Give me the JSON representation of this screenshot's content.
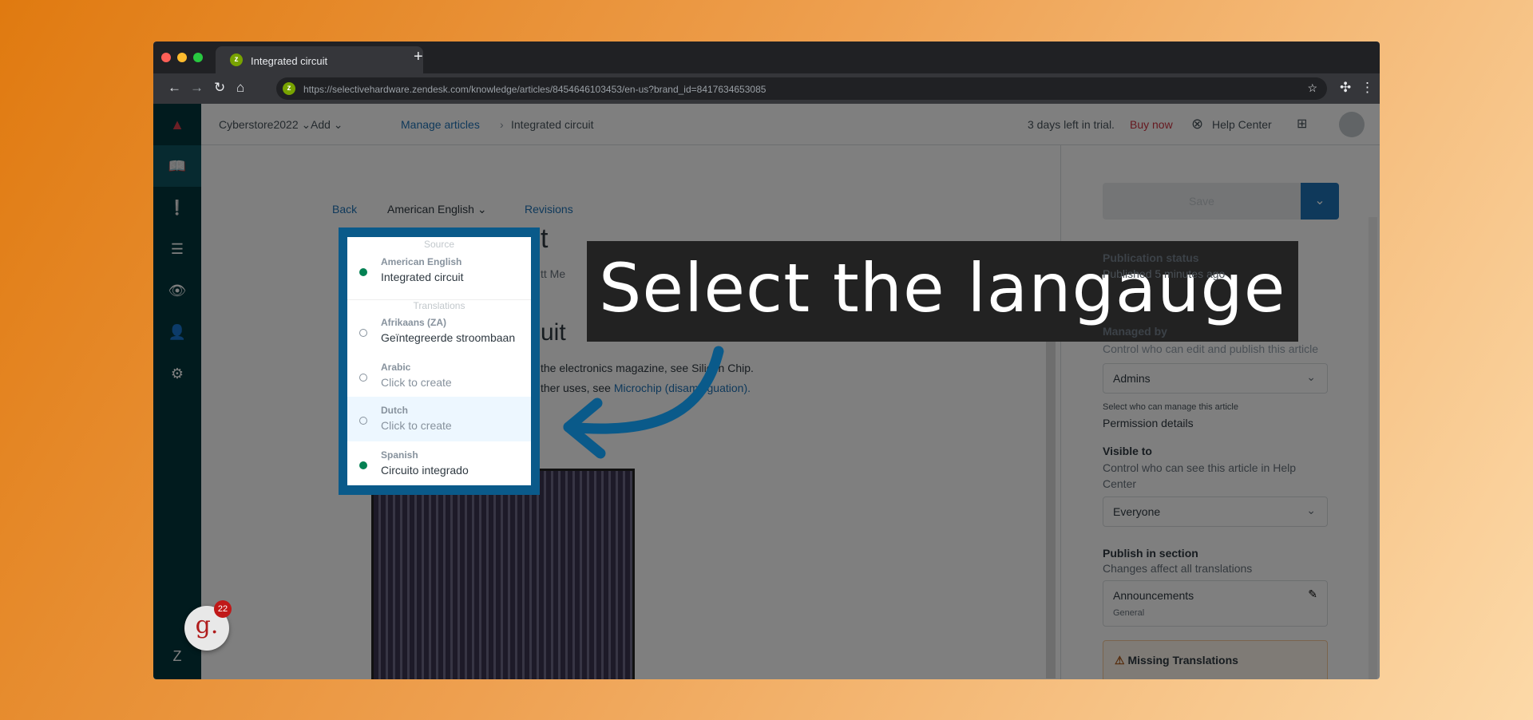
{
  "browser": {
    "tab_title": "Integrated circuit",
    "url": "https://selectivehardware.zendesk.com/knowledge/articles/8454646103453/en-us?brand_id=8417634653085",
    "new_tab": "+"
  },
  "header": {
    "brand": "Cyberstore2022",
    "add": "Add",
    "breadcrumb": [
      "Manage articles",
      "Integrated circuit"
    ],
    "trial": "3 days left in trial.",
    "buy": "Buy now",
    "help_center": "Help Center"
  },
  "editor": {
    "back": "Back",
    "language": "American English",
    "revisions": "Revisions",
    "title_fragment": "t",
    "author_fragment": "tt Me",
    "heading_fragment": "uit",
    "para1": "the electronics magazine, see Silicon Chip.",
    "para2_a": "ther uses, see ",
    "para2_link": "Microchip (disambiguation)."
  },
  "dropdown": {
    "source_label": "Source",
    "translations_label": "Translations",
    "items": [
      {
        "lang": "American English",
        "title": "Integrated circuit",
        "status": "published"
      },
      {
        "lang": "Afrikaans (ZA)",
        "title": "Geïntegreerde stroombaan",
        "status": "draft"
      },
      {
        "lang": "Arabic",
        "title": "Click to create",
        "status": "none"
      },
      {
        "lang": "Dutch",
        "title": "Click to create",
        "status": "none",
        "highlighted": true
      },
      {
        "lang": "Spanish",
        "title": "Circuito integrado",
        "status": "published"
      }
    ]
  },
  "panel": {
    "save": "Save",
    "pub_status": "Publication status",
    "pub_value": "Published 5 minutes ago",
    "managed_by": "Managed by",
    "managed_desc": "Control who can edit and publish this article",
    "managed_value": "Admins",
    "managed_hint": "Select who can manage this article",
    "permission_link": "Permission details",
    "visible_to": "Visible to",
    "visible_desc": "Control who can see this article in Help Center",
    "visible_value": "Everyone",
    "publish_in": "Publish in section",
    "publish_desc": "Changes affect all translations",
    "section": "Announcements",
    "section_sub": "General",
    "missing": "Missing Translations"
  },
  "widget": {
    "letter": "g.",
    "count": "22"
  },
  "callout": {
    "text": "Select the langauge"
  },
  "colors": {
    "accent": "#0a5a8a",
    "sidebar": "#03363d",
    "green": "#038153",
    "buy": "#cc3340"
  }
}
